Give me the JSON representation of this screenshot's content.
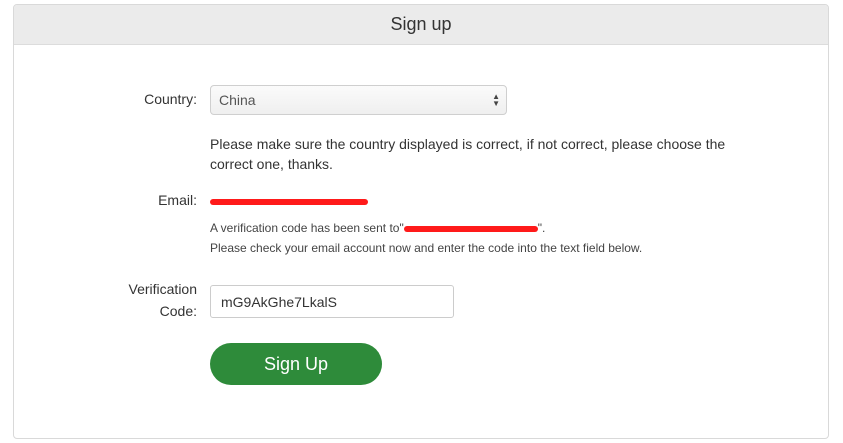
{
  "header": {
    "title": "Sign up"
  },
  "form": {
    "country_label": "Country:",
    "country_value": "China",
    "country_note": "Please make sure the country displayed is correct, if not correct, please choose the correct one, thanks.",
    "email_label": "Email:",
    "verification_sent_prefix": "A verification code has been sent to\"",
    "verification_sent_suffix": "\".",
    "verification_instruction": "Please check your email account now and enter the code into the text field below.",
    "code_label_line1": "Verification",
    "code_label_line2": "Code:",
    "code_value": "mG9AkGhe7LkalS",
    "submit_label": "Sign Up"
  },
  "icons": {
    "select_arrows": "updown-chevron-icon"
  },
  "colors": {
    "accent": "#2e8b3a",
    "redaction": "#ff1a1a",
    "header_bg": "#ebebeb"
  }
}
